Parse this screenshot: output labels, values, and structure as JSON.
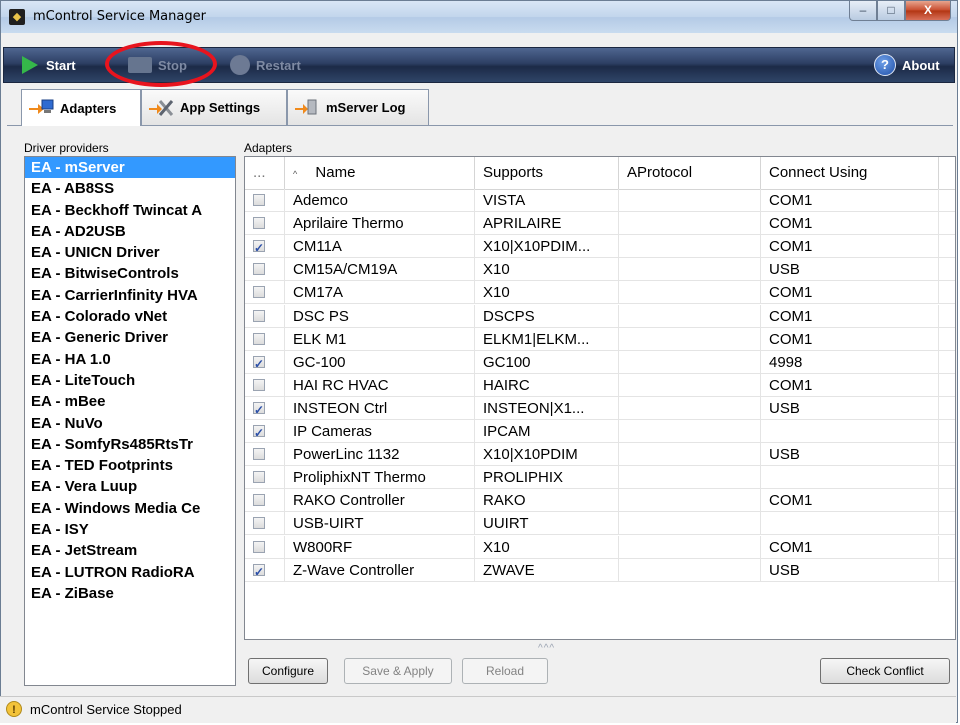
{
  "window": {
    "title": "mControl Service Manager",
    "minimize": "‒",
    "maximize": "□",
    "close": "X"
  },
  "toolbar": {
    "start": "Start",
    "stop": "Stop",
    "restart": "Restart",
    "about": "About",
    "about_glyph": "?"
  },
  "tabs": [
    {
      "label": "Adapters",
      "icon": "adapters-icon"
    },
    {
      "label": "App Settings",
      "icon": "tools-icon"
    },
    {
      "label": "mServer Log",
      "icon": "log-icon"
    }
  ],
  "drivers": {
    "label": "Driver providers",
    "selected": 0,
    "items": [
      "EA - mServer",
      "EA - AB8SS",
      "EA - Beckhoff Twincat A",
      "EA - AD2USB",
      "EA - UNICN Driver",
      "EA - BitwiseControls",
      "EA - CarrierInfinity HVA",
      "EA - Colorado vNet",
      "EA - Generic Driver",
      "EA - HA 1.0",
      "EA - LiteTouch",
      "EA - mBee",
      "EA - NuVo",
      "EA - SomfyRs485RtsTr",
      "EA - TED Footprints",
      "EA - Vera Luup",
      "EA - Windows Media Ce",
      "EA - ISY",
      "EA - JetStream",
      "EA - LUTRON RadioRA",
      "EA - ZiBase"
    ]
  },
  "adapters": {
    "label": "Adapters",
    "columns": {
      "check": "...",
      "sort": "^",
      "name": "Name",
      "supports": "Supports",
      "protocol": "AProtocol",
      "connect": "Connect Using"
    },
    "rows": [
      {
        "checked": false,
        "name": "Ademco",
        "supports": "VISTA",
        "protocol": "",
        "connect": "COM1"
      },
      {
        "checked": false,
        "name": "Aprilaire Thermo",
        "supports": "APRILAIRE",
        "protocol": "",
        "connect": "COM1"
      },
      {
        "checked": true,
        "name": "CM11A",
        "supports": "X10|X10PDIM...",
        "protocol": "",
        "connect": "COM1"
      },
      {
        "checked": false,
        "name": "CM15A/CM19A",
        "supports": "X10",
        "protocol": "",
        "connect": "USB"
      },
      {
        "checked": false,
        "name": "CM17A",
        "supports": "X10",
        "protocol": "",
        "connect": "COM1"
      },
      {
        "checked": false,
        "name": "DSC PS",
        "supports": "DSCPS",
        "protocol": "",
        "connect": "COM1"
      },
      {
        "checked": false,
        "name": "ELK M1",
        "supports": "ELKM1|ELKM...",
        "protocol": "",
        "connect": "COM1"
      },
      {
        "checked": true,
        "name": "GC-100",
        "supports": "GC100",
        "protocol": "",
        "connect": "4998"
      },
      {
        "checked": false,
        "name": "HAI RC HVAC",
        "supports": "HAIRC",
        "protocol": "",
        "connect": "COM1"
      },
      {
        "checked": true,
        "name": "INSTEON Ctrl",
        "supports": "INSTEON|X1...",
        "protocol": "",
        "connect": "USB"
      },
      {
        "checked": true,
        "name": "IP Cameras",
        "supports": "IPCAM",
        "protocol": "",
        "connect": ""
      },
      {
        "checked": false,
        "name": "PowerLinc 1132",
        "supports": "X10|X10PDIM",
        "protocol": "",
        "connect": "USB"
      },
      {
        "checked": false,
        "name": "ProliphixNT Thermo",
        "supports": "PROLIPHIX",
        "protocol": "",
        "connect": ""
      },
      {
        "checked": false,
        "name": "RAKO Controller",
        "supports": "RAKO",
        "protocol": "",
        "connect": "COM1"
      },
      {
        "checked": false,
        "name": "USB-UIRT",
        "supports": "UUIRT",
        "protocol": "",
        "connect": ""
      },
      {
        "checked": false,
        "name": "W800RF",
        "supports": "X10",
        "protocol": "",
        "connect": "COM1"
      },
      {
        "checked": true,
        "name": "Z-Wave Controller",
        "supports": "ZWAVE",
        "protocol": "",
        "connect": "USB"
      }
    ],
    "grip": "^^^"
  },
  "buttons": {
    "configure": "Configure",
    "save_apply": "Save & Apply",
    "reload": "Reload",
    "check_conflict": "Check Conflict"
  },
  "status": {
    "text": "mControl Service Stopped",
    "icon": "warning-icon",
    "glyph": "!"
  },
  "colors": {
    "selection": "#3399ff",
    "highlight_oval": "#e8141e",
    "toolbar": "#2d3f64"
  }
}
